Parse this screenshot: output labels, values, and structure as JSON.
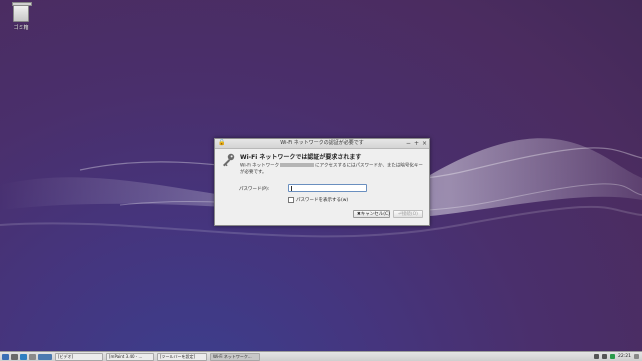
{
  "desktop": {
    "trash_label": "ゴミ箱"
  },
  "dialog": {
    "title": "Wi-Fi ネットワークの認証が必要です",
    "controls": {
      "minimize": "−",
      "maximize": "+",
      "close": "×"
    },
    "heading": "Wi-Fi ネットワークでは認証が要求されます",
    "desc_prefix": "Wi-Fi ネットワーク",
    "desc_suffix": "にアクセスするにはパスワードか、または暗号化キーが必要です。",
    "password_label": "パスワード(P):",
    "password_value": "",
    "show_password_label": "パスワードを表示する(w)",
    "cancel_label": "✖キャンセル(C)",
    "connect_label": "⏎接続(O)"
  },
  "taskbar": {
    "tasks": [
      {
        "label": "[ビデオ]"
      },
      {
        "label": "[mPaint 3.40 - ..."
      },
      {
        "label": "[ツールバーを設定]"
      },
      {
        "label": "Wi-Fi ネットワーク..."
      }
    ],
    "clock": "22:21"
  },
  "colors": {
    "desktop_bg": "#4a2f6c",
    "dialog_bg": "#efefef",
    "focus_border": "#6a8fbf"
  },
  "icons": {
    "dialog_icon": "key-icon",
    "taskbar_start": "menu-icon"
  }
}
